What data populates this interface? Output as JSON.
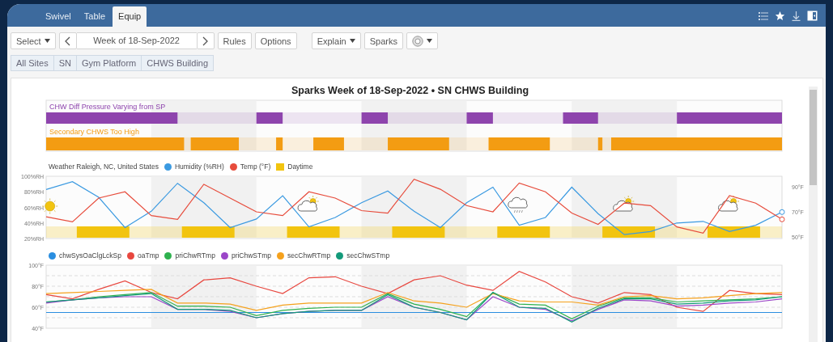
{
  "tabs": [
    {
      "label": "Swivel",
      "selected": false
    },
    {
      "label": "Table",
      "selected": false
    },
    {
      "label": "Equip",
      "selected": true
    }
  ],
  "toolbar_groups": [
    [
      {
        "kind": "dropdown",
        "label": "Select"
      },
      {
        "kind": "date_nav",
        "label": "Week of 18-Sep-2022"
      },
      {
        "kind": "button",
        "label": "Rules"
      },
      {
        "kind": "button",
        "label": "Options"
      }
    ],
    [
      {
        "kind": "dropdown",
        "label": "Explain"
      },
      {
        "kind": "button",
        "label": "Sparks"
      },
      {
        "kind": "icon_dropdown"
      }
    ]
  ],
  "breadcrumbs": [
    "All Sites",
    "SN",
    "Gym Platform",
    "CHWS Building"
  ],
  "title": "Sparks Week of 18-Sep-2022 • SN CHWS Building",
  "sparks": [
    {
      "label": "CHW Diff Pressure Varying from SP",
      "color": "#8e44ad"
    },
    {
      "label": "Secondary CHWS Too High",
      "color": "#f39c12"
    }
  ],
  "weather": {
    "title": "Weather Raleigh, NC, United States",
    "daytime": {
      "label": "Daytime",
      "color": "#f2c40f"
    },
    "chart_data": {
      "type": "line",
      "ylim": [
        20,
        100
      ],
      "y2lim": [
        48.7,
        98.4
      ],
      "yticks": [
        {
          "value": 100,
          "label": "100%RH"
        },
        {
          "value": 80,
          "label": "80%RH"
        },
        {
          "value": 60,
          "label": "60%RH"
        },
        {
          "value": 40,
          "label": "40%RH"
        },
        {
          "value": 20,
          "label": "20%RH"
        }
      ],
      "y2ticks": [
        {
          "value": 90,
          "label": "90°F"
        },
        {
          "value": 70,
          "label": "70°F"
        },
        {
          "value": 50,
          "label": "50°F"
        }
      ],
      "series": [
        {
          "name": "Humidity (%RH)",
          "color": "#3b9ae1",
          "values": [
            83,
            93,
            73,
            34,
            55,
            91,
            66,
            34,
            45,
            75,
            35,
            47,
            66,
            81,
            55,
            34,
            66,
            86,
            37,
            47,
            86,
            52,
            25,
            29,
            40,
            42,
            29,
            37,
            54
          ]
        },
        {
          "name": "Temp (°F)",
          "color": "#e74c3c",
          "axis": "y2",
          "values": [
            66,
            62,
            81,
            86,
            67,
            64,
            92,
            81,
            70,
            67,
            86,
            81,
            71,
            69,
            96,
            88,
            75,
            70,
            93,
            86,
            69,
            60,
            77,
            75,
            58,
            53,
            83,
            77,
            64
          ]
        }
      ]
    }
  },
  "trends": {
    "chart_data": {
      "type": "line",
      "ylim": [
        40,
        100
      ],
      "yticks": [
        {
          "value": 100,
          "label": "100°F"
        },
        {
          "value": 80,
          "label": "80°F"
        },
        {
          "value": 60,
          "label": "60°F"
        },
        {
          "value": 40,
          "label": "40°F"
        }
      ],
      "series": [
        {
          "name": "chwSysOaClgLckSp",
          "color": "#2a8ee0",
          "values": [
            55,
            55,
            55,
            55,
            55,
            55,
            55,
            55,
            55,
            55,
            55,
            55,
            55,
            55,
            55,
            55,
            55,
            55,
            55,
            55,
            55,
            55,
            55,
            55,
            55,
            55,
            55,
            55,
            55
          ]
        },
        {
          "name": "oaTmp",
          "color": "#e8473f",
          "values": [
            72,
            68,
            77,
            85,
            74,
            68,
            86,
            88,
            80,
            73,
            88,
            89,
            80,
            73,
            86,
            90,
            81,
            76,
            94,
            84,
            70,
            64,
            74,
            72,
            60,
            56,
            76,
            73,
            72
          ]
        },
        {
          "name": "priChwRTmp",
          "color": "#2eb14e",
          "values": [
            65,
            67,
            70,
            72,
            74,
            61,
            61,
            60,
            52,
            57,
            59,
            60,
            60,
            73,
            63,
            58,
            51,
            74,
            63,
            62,
            49,
            61,
            69,
            69,
            65,
            66,
            67,
            68,
            70
          ]
        },
        {
          "name": "priChwSTmp",
          "color": "#9b46c8",
          "values": [
            64,
            67,
            69,
            70,
            70,
            58,
            58,
            56,
            50,
            54,
            56,
            57,
            57,
            70,
            60,
            55,
            48,
            70,
            60,
            58,
            47,
            58,
            67,
            66,
            61,
            62,
            64,
            65,
            68
          ]
        },
        {
          "name": "secChwRTmp",
          "color": "#f5a11c",
          "values": [
            73,
            74,
            75,
            76,
            77,
            64,
            64,
            63,
            57,
            62,
            64,
            64,
            64,
            74,
            66,
            64,
            60,
            73,
            66,
            65,
            65,
            62,
            70,
            71,
            68,
            69,
            71,
            73,
            74
          ]
        },
        {
          "name": "secChwSTmp",
          "color": "#139a7a",
          "values": [
            65,
            67,
            69,
            71,
            73,
            58,
            58,
            57,
            50,
            54,
            56,
            57,
            57,
            72,
            60,
            55,
            48,
            74,
            60,
            59,
            46,
            59,
            68,
            68,
            63,
            64,
            66,
            67,
            70
          ]
        }
      ]
    }
  }
}
